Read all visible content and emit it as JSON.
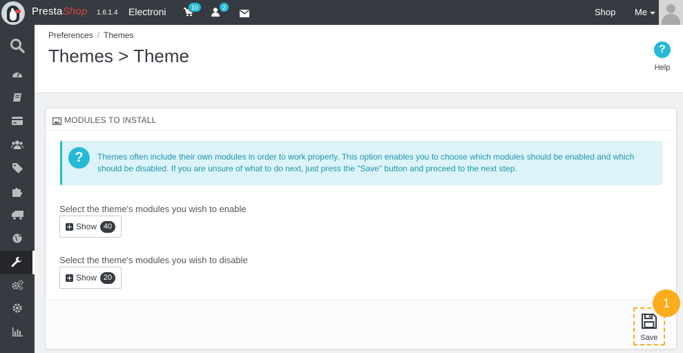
{
  "topbar": {
    "brand_presta": "Presta",
    "brand_shop": "Shop",
    "version": "1.6.1.4",
    "store_name": "Electroni",
    "cart_count": "10",
    "customers_count": "2",
    "shop_link": "Shop",
    "me_link": "Me"
  },
  "breadcrumb": {
    "parent": "Preferences",
    "separator": "/",
    "current": "Themes"
  },
  "page_title": "Themes > Theme",
  "help_label": "Help",
  "panel": {
    "heading": "MODULES TO INSTALL",
    "alert_text": "Themes often include their own modules in order to work properly. This option enables you to choose which modules should be enabled and which should be disabled. If you are unsure of what to do next, just press the \"Save\" button and proceed to the next step.",
    "enable_label": "Select the theme's modules you wish to enable",
    "enable_button": "Show",
    "enable_count": "40",
    "disable_label": "Select the theme's modules you wish to disable",
    "disable_button": "Show",
    "disable_count": "20",
    "save_label": "Save",
    "step_number": "1"
  },
  "colors": {
    "dark": "#363a41",
    "accent": "#25b9d7",
    "brand_red": "#e0453d",
    "highlight": "#fcac1c"
  }
}
